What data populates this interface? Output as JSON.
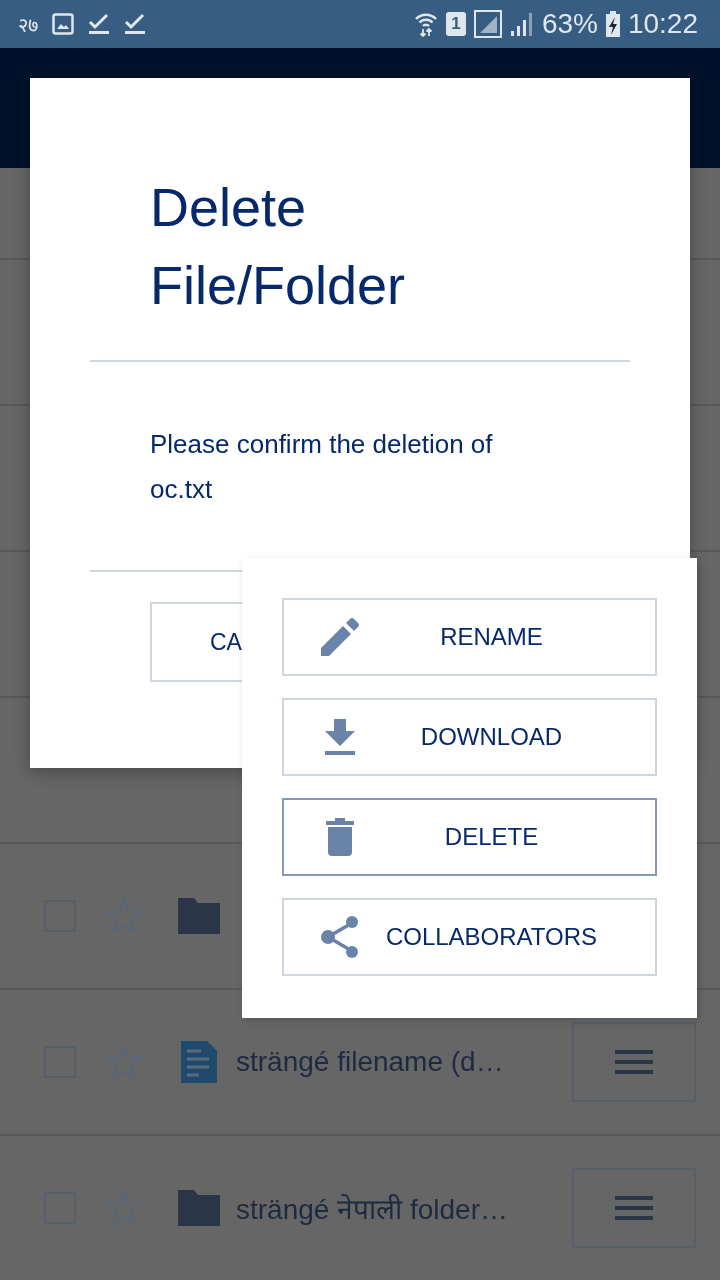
{
  "status_bar": {
    "date": "२७",
    "sim_label": "1",
    "battery": "63%",
    "time": "10:22"
  },
  "files": [
    {
      "kind": "folder",
      "checked": false,
      "starred": false
    },
    {
      "kind": "file",
      "name": "strängé filename (d…",
      "checked": false,
      "starred": false,
      "menu": true
    },
    {
      "kind": "folder",
      "name": "strängé नेपाली folder…",
      "checked": false,
      "starred": false,
      "menu": true
    }
  ],
  "dialog": {
    "title": "Delete File/Folder",
    "message": "Please confirm the deletion of oc.txt",
    "cancel_button": "CA"
  },
  "context_menu": [
    {
      "kind": "rename",
      "label": "RENAME",
      "focused": false
    },
    {
      "kind": "download",
      "label": "DOWNLOAD",
      "focused": false
    },
    {
      "kind": "delete",
      "label": "DELETE",
      "focused": true
    },
    {
      "kind": "share",
      "label": "COLLABORATORS",
      "focused": false
    }
  ]
}
